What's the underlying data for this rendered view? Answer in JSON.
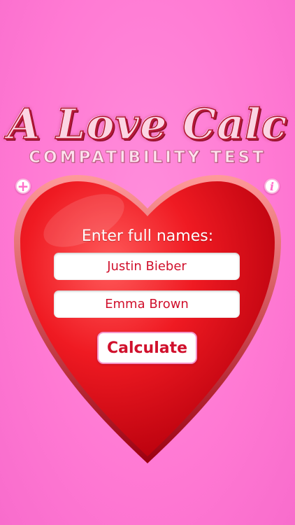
{
  "app": {
    "title": "A Love Calc",
    "subtitle": "COMPATIBILITY TEST"
  },
  "toolbar": {
    "add_symbol": "+",
    "info_symbol": "i"
  },
  "form": {
    "prompt": "Enter full names:",
    "name1_value": "Justin Bieber",
    "name2_value": "Emma Brown",
    "calculate_label": "Calculate"
  },
  "colors": {
    "background": "#ff79d3",
    "heart": "#e8101f",
    "input_text": "#d0102c"
  },
  "icons": {
    "add": "plus-circle-icon",
    "info": "info-circle-icon",
    "heart": "heart-icon"
  }
}
